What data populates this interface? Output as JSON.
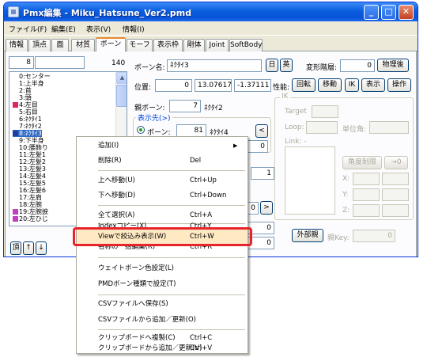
{
  "window": {
    "title": "Pmx編集 - Miku_Hatsune_Ver2.pmd",
    "controls": {
      "minimize": "_",
      "maximize": "□",
      "close": "✕"
    }
  },
  "menubar": [
    "ファイル(F)",
    "編集(E)",
    "表示(V)",
    "情報(I)"
  ],
  "tabs": [
    "情報",
    "頂点",
    "面",
    "材質",
    "ボーン",
    "モーフ",
    "表示枠",
    "剛体",
    "Joint",
    "SoftBody"
  ],
  "active_tab": "ボーン",
  "bone_list": {
    "search_value": "8",
    "count": "140",
    "items": [
      {
        "label": "0:センター",
        "color": ""
      },
      {
        "label": "1:上半身",
        "color": ""
      },
      {
        "label": "2:首",
        "color": ""
      },
      {
        "label": "3:頭",
        "color": ""
      },
      {
        "label": "4:左目",
        "color": "#e0245e"
      },
      {
        "label": "5:右目",
        "color": ""
      },
      {
        "label": "6:ﾈｸﾀｲ1",
        "color": ""
      },
      {
        "label": "7:ﾈｸﾀｲ2",
        "color": ""
      },
      {
        "label": "8:ﾈｸﾀｲ3",
        "color": "#1f3fa0",
        "selected": true
      },
      {
        "label": "9:下半身",
        "color": ""
      },
      {
        "label": "10:腰飾り",
        "color": ""
      },
      {
        "label": "11:左髪1",
        "color": ""
      },
      {
        "label": "12:左髪2",
        "color": ""
      },
      {
        "label": "13:左髪3",
        "color": ""
      },
      {
        "label": "14:左髪4",
        "color": ""
      },
      {
        "label": "15:左髪5",
        "color": ""
      },
      {
        "label": "16:左髪6",
        "color": ""
      },
      {
        "label": "17:左肩",
        "color": ""
      },
      {
        "label": "18:左腕",
        "color": ""
      },
      {
        "label": "19:左腕捩",
        "color": "#c040c0"
      },
      {
        "label": "20:左ひじ",
        "color": "#c040c0"
      }
    ],
    "nav_buttons": [
      "頂",
      "↑",
      "↓"
    ]
  },
  "bone_form": {
    "name_label": "ボーン名:",
    "name_value": "ﾈｸﾀｲ3",
    "ja_button": "日",
    "en_button": "英",
    "transform_level_label": "変形階層:",
    "transform_level_value": "0",
    "after_physics_button": "物理後",
    "position_label": "位置:",
    "position_x": "0",
    "position_y": "13.07617",
    "position_z": "-1.37111",
    "performance_label": "性能:",
    "perf_rotate": "回転",
    "perf_move": "移動",
    "perf_ik": "IK",
    "perf_visible": "表示",
    "perf_operate": "操作",
    "parent_label": "親ボーン:",
    "parent_index": "7",
    "parent_name": "ﾈｸﾀｲ2",
    "display_dest_title": "表示先(>)",
    "radio_bone_label": "ボーン:",
    "dest_index": "81",
    "dest_name": "ﾈｸﾀｲ4",
    "left_arrow": "<",
    "right_arrow": ">",
    "partial_field_values": [
      "0",
      "1",
      "0",
      "0",
      "0"
    ],
    "external_parent_button": "外部親",
    "parent_key_label": "親Key:",
    "parent_key_value": "0"
  },
  "ik_group": {
    "title": "IK",
    "target_label": "Target",
    "loop_label": "Loop:",
    "unit_angle_label": "単位角:",
    "link_label": "Link: -",
    "angle_limit_button": "角度制限",
    "arrow_button": "→0",
    "x_label": "X:",
    "y_label": "Y:",
    "z_label": "Z:"
  },
  "context_menu": [
    {
      "label": "追加(I)",
      "shortcut": "",
      "submenu": true
    },
    {
      "label": "削除(R)",
      "shortcut": "Del"
    },
    {
      "separator": true
    },
    {
      "label": "上へ移動(U)",
      "shortcut": "Ctrl+Up"
    },
    {
      "label": "下へ移動(D)",
      "shortcut": "Ctrl+Down"
    },
    {
      "separator": true
    },
    {
      "label": "全て選択(A)",
      "shortcut": "Ctrl+A"
    },
    {
      "separator": true
    },
    {
      "label": "Indexコピー(X)",
      "shortcut": "Ctrl+Y"
    },
    {
      "label": "Viewで絞込み表示(W)",
      "shortcut": "Ctrl+W",
      "highlighted": true
    },
    {
      "label": "名称の一括編集(R)",
      "shortcut": "Ctrl+R"
    },
    {
      "separator": true
    },
    {
      "label": "ウェイトボーン色設定(L)",
      "shortcut": ""
    },
    {
      "label": "PMDボーン種類で設定(T)",
      "shortcut": ""
    },
    {
      "separator": true
    },
    {
      "label": "CSVファイルへ保存(S)",
      "shortcut": ""
    },
    {
      "label": "CSVファイルから追加／更新(O)",
      "shortcut": ""
    },
    {
      "separator": true
    },
    {
      "label": "クリップボードへ複製(C)",
      "shortcut": "Ctrl+C"
    },
    {
      "label": "クリップボードから追加／更新(V)",
      "shortcut": "Ctrl+V"
    }
  ]
}
